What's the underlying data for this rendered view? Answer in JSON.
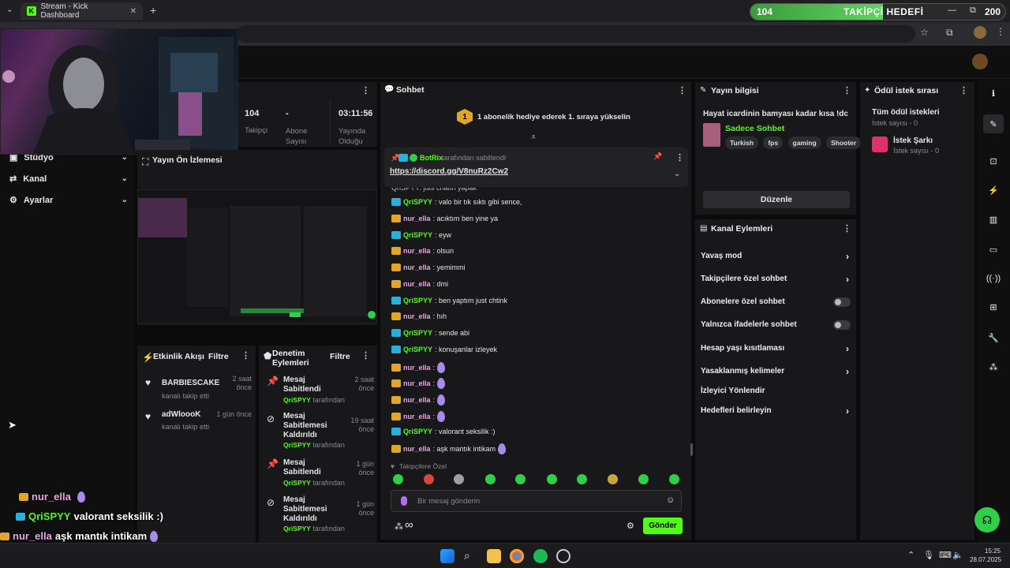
{
  "browser": {
    "tab_title": "Stream - Kick Dashboard",
    "tab_logo": "K",
    "goal": {
      "current": "104",
      "title": "TAKİPÇİ HEDEFİ",
      "target": "200",
      "progress": 0.52
    }
  },
  "stats": [
    {
      "value": "104",
      "label": "Takipçi"
    },
    {
      "value": "-",
      "label": "Abone Sayısı"
    },
    {
      "value": "03:11:56",
      "label": "Yayında Olduğu"
    }
  ],
  "sidebar": {
    "items": [
      {
        "label": "Stüdyo"
      },
      {
        "label": "Kanal"
      },
      {
        "label": "Ayarlar"
      }
    ]
  },
  "preview": {
    "title": "Yayın Ön İzlemesi"
  },
  "activity": {
    "title": "Etkinlik Akışı",
    "filter": "Filtre",
    "items": [
      {
        "name": "BARBIESCAKE",
        "desc": "kanalı takip etti",
        "time": "2 saat önce"
      },
      {
        "name": "adWloooK",
        "desc": "kanalı takip etti",
        "time": "1 gün önce"
      }
    ]
  },
  "moderation": {
    "title": "Denetim Eylemleri",
    "filter": "Filtre",
    "items": [
      {
        "action": "Mesaj Sabitlendi",
        "by": "QriSPYY",
        "suffix": "tarafından",
        "time": "2 saat önce"
      },
      {
        "action": "Mesaj Sabitlemesi Kaldırıldı",
        "by": "QriSPYY",
        "suffix": "tarafından",
        "time": "19 saat önce"
      },
      {
        "action": "Mesaj Sabitlendi",
        "by": "QriSPYY",
        "suffix": "tarafından",
        "time": "1 gün önce"
      },
      {
        "action": "Mesaj Sabitlemesi Kaldırıldı",
        "by": "QriSPYY",
        "suffix": "tarafından",
        "time": "1 gün önce"
      }
    ]
  },
  "chat": {
    "title": "Sohbet",
    "gift_rank": "1",
    "gift_text": "1 abonelik hediye ederek 1. sıraya yükselin",
    "pinned_by": "BotRix",
    "pinned_suffix": "tarafından sabitlendi",
    "pinned_link": "https://discord.gg/V8nuRz2Cw2",
    "partial_top": "QriSPYY: juts chatın yapak",
    "messages": [
      {
        "user": "QriSPYY",
        "text": ": valo bir tık sıktı gibi sence,",
        "role": "mod"
      },
      {
        "user": "nur_ella",
        "text": ": acıktım ben yine ya",
        "role": "sub"
      },
      {
        "user": "QriSPYY",
        "text": ": eyw",
        "role": "mod"
      },
      {
        "user": "nur_ella",
        "text": ": olsun",
        "role": "sub"
      },
      {
        "user": "nur_ella",
        "text": ": yemimmi",
        "role": "sub"
      },
      {
        "user": "nur_ella",
        "text": ": dmi",
        "role": "sub"
      },
      {
        "user": "QriSPYY",
        "text": ": ben yaptım just chtink",
        "role": "mod"
      },
      {
        "user": "nur_ella",
        "text": ": hıh",
        "role": "sub"
      },
      {
        "user": "QriSPYY",
        "text": ": sende abi",
        "role": "mod"
      },
      {
        "user": "QriSPYY",
        "text": ": konuşanlar izleyek",
        "role": "mod"
      },
      {
        "user": "nur_ella",
        "text": ":",
        "role": "sub",
        "emote": true
      },
      {
        "user": "nur_ella",
        "text": ":",
        "role": "sub",
        "emote": true
      },
      {
        "user": "nur_ella",
        "text": ":",
        "role": "sub",
        "emote": true
      },
      {
        "user": "nur_ella",
        "text": ":",
        "role": "sub",
        "emote": true
      },
      {
        "user": "QriSPYY",
        "text": ": valorant seksilik :)",
        "role": "mod"
      },
      {
        "user": "nur_ella",
        "text": ": aşk mantık intikam",
        "role": "sub",
        "emote": true
      }
    ],
    "followers_only": "Takipçilere Özel",
    "input_placeholder": "Bir mesaj gönderin",
    "send_label": "Gönder",
    "infinity": "∞"
  },
  "stream_info": {
    "title": "Yayın bilgisi",
    "stream_title": "Hayat icardinin bamyası kadar kısa !dc",
    "category": "Sadece Sohbet",
    "tags": [
      "Turkish",
      "fps",
      "gaming",
      "Shooter"
    ],
    "edit_label": "Düzenle"
  },
  "channel_actions": {
    "title": "Kanal Eylemleri",
    "rows": [
      {
        "label": "Yavaş mod",
        "type": "chevron"
      },
      {
        "label": "Takipçilere özel sohbet",
        "type": "chevron"
      },
      {
        "label": "Abonelere özel sohbet",
        "type": "toggle"
      },
      {
        "label": "Yalnızca ifadelerle sohbet",
        "type": "toggle"
      },
      {
        "label": "Hesap yaşı kısıtlaması",
        "type": "chevron"
      },
      {
        "label": "Yasaklanmış kelimeler",
        "type": "chevron"
      },
      {
        "label": "İzleyici Yönlendir",
        "type": "none"
      },
      {
        "label": "Hedefleri belirleyin",
        "type": "chevron"
      }
    ]
  },
  "rewards": {
    "title": "Ödül istek sırası",
    "all_title": "Tüm ödül istekleri",
    "all_count": "İstek sayısı - 0",
    "song_title": "İstek Şarkı",
    "song_count": "İstek sayısı - 0"
  },
  "overlay_chat": [
    {
      "user": "nur_ella",
      "text": "",
      "role": "sub",
      "emote": true
    },
    {
      "user": "QriSPYY",
      "text": "valorant seksilik :)",
      "role": "mod"
    },
    {
      "user": "nur_ella",
      "text": "aşk mantık intikam",
      "role": "sub",
      "emote": true
    }
  ],
  "taskbar": {
    "time": "15:25",
    "date": "28.07.2025"
  },
  "colors": {
    "accent": "#53fc18",
    "panel": "#18181a",
    "bg": "#0b0b0c",
    "sub_user": "#e9a7e0"
  }
}
